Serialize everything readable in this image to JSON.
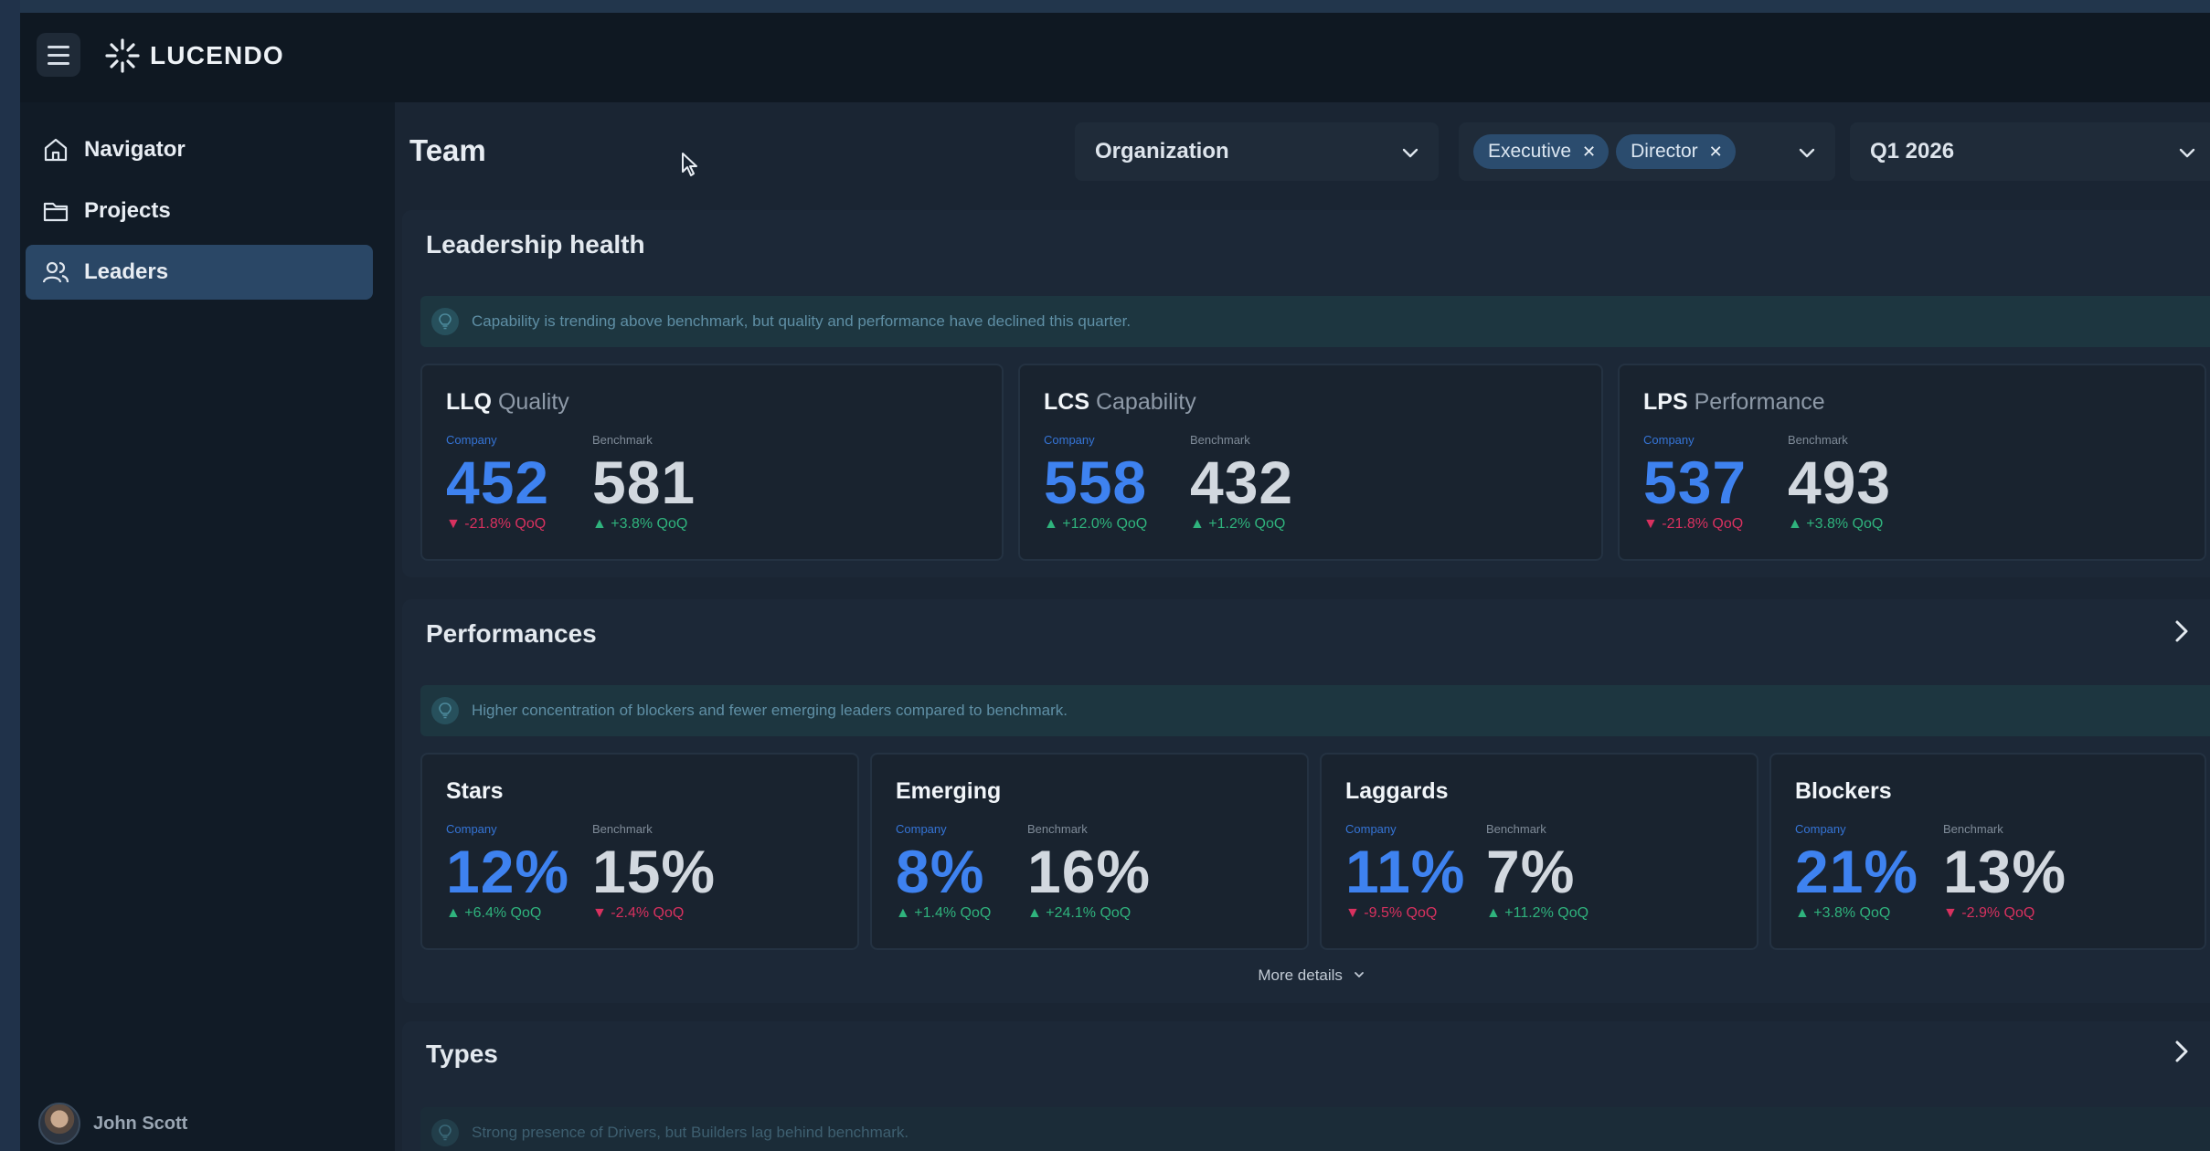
{
  "app": {
    "brand": "LUCENDO"
  },
  "sidebar": {
    "items": [
      {
        "label": "Navigator",
        "icon": "home-icon",
        "active": false
      },
      {
        "label": "Projects",
        "icon": "folder-icon",
        "active": false
      },
      {
        "label": "Leaders",
        "icon": "users-icon",
        "active": true
      }
    ],
    "user": {
      "name": "John Scott"
    }
  },
  "main": {
    "title": "Team",
    "filters": {
      "organization": "Organization",
      "roles": [
        "Executive",
        "Director"
      ],
      "period": "Q1 2026"
    }
  },
  "leadership": {
    "title": "Leadership health",
    "insight": "Capability is trending above benchmark, but quality and performance have declined this quarter.",
    "company_label": "Company",
    "benchmark_label": "Benchmark",
    "cards": [
      {
        "code": "LLQ",
        "name": "Quality",
        "company": "452",
        "company_delta": "▼ -21.8% QoQ",
        "company_trend": "down",
        "benchmark": "581",
        "benchmark_delta": "▲ +3.8% QoQ",
        "benchmark_trend": "up"
      },
      {
        "code": "LCS",
        "name": "Capability",
        "company": "558",
        "company_delta": "▲ +12.0% QoQ",
        "company_trend": "up",
        "benchmark": "432",
        "benchmark_delta": "▲ +1.2% QoQ",
        "benchmark_trend": "up"
      },
      {
        "code": "LPS",
        "name": "Performance",
        "company": "537",
        "company_delta": "▼ -21.8% QoQ",
        "company_trend": "down",
        "benchmark": "493",
        "benchmark_delta": "▲ +3.8% QoQ",
        "benchmark_trend": "up"
      }
    ]
  },
  "performances": {
    "title": "Performances",
    "insight": "Higher concentration of blockers and fewer emerging leaders compared to benchmark.",
    "cards": [
      {
        "name": "Stars",
        "company": "12%",
        "company_delta": "▲ +6.4% QoQ",
        "company_trend": "up",
        "benchmark": "15%",
        "benchmark_delta": "▼ -2.4% QoQ",
        "benchmark_trend": "down"
      },
      {
        "name": "Emerging",
        "company": "8%",
        "company_delta": "▲ +1.4% QoQ",
        "company_trend": "up",
        "benchmark": "16%",
        "benchmark_delta": "▲ +24.1% QoQ",
        "benchmark_trend": "up"
      },
      {
        "name": "Laggards",
        "company": "11%",
        "company_delta": "▼ -9.5% QoQ",
        "company_trend": "down",
        "benchmark": "7%",
        "benchmark_delta": "▲ +11.2% QoQ",
        "benchmark_trend": "up"
      },
      {
        "name": "Blockers",
        "company": "21%",
        "company_delta": "▲ +3.8% QoQ",
        "company_trend": "up",
        "benchmark": "13%",
        "benchmark_delta": "▼ -2.9% QoQ",
        "benchmark_trend": "down"
      }
    ],
    "more": "More details"
  },
  "types": {
    "title": "Types",
    "insight": "Strong presence of Drivers, but Builders lag behind benchmark."
  },
  "colors": {
    "accent": "#3e82f0",
    "up": "#2fb37d",
    "down": "#d8315f",
    "active_nav": "#2a4766"
  }
}
